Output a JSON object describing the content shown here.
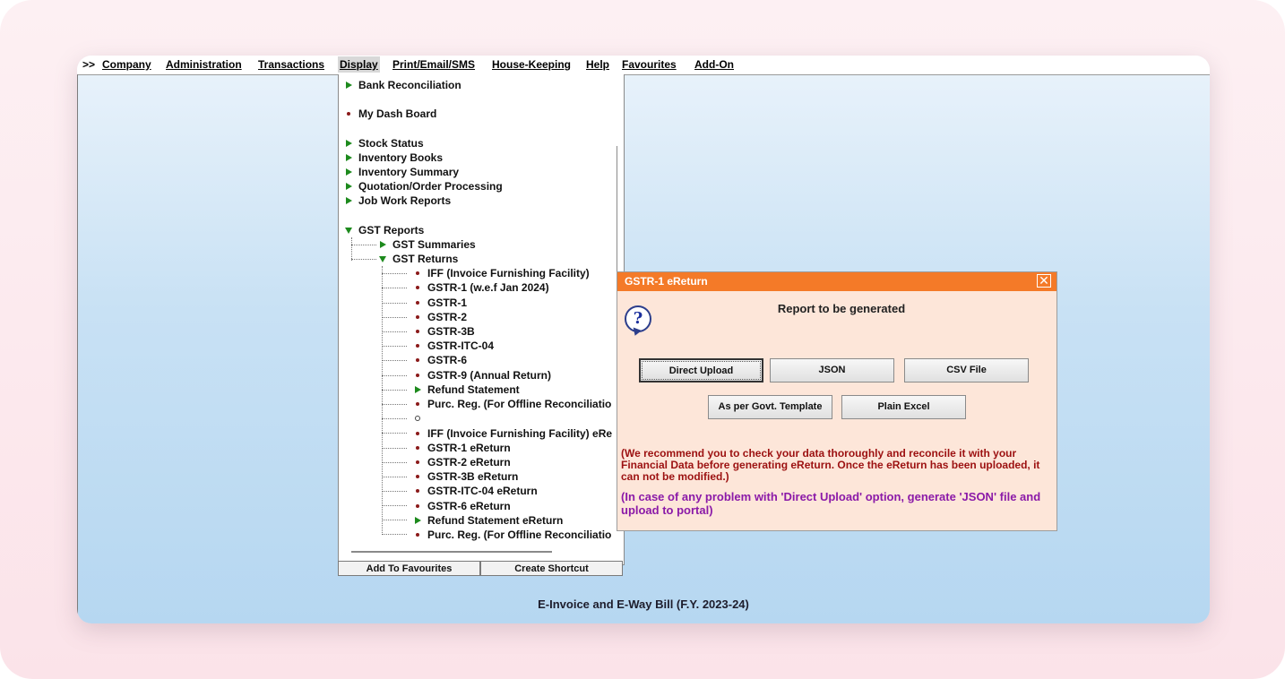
{
  "menubar": {
    "chevron": ">>",
    "items": [
      {
        "label": "Company"
      },
      {
        "label": "Administration"
      },
      {
        "label": "Transactions"
      },
      {
        "label": "Display"
      },
      {
        "label": "Print/Email/SMS"
      },
      {
        "label": "House-Keeping"
      },
      {
        "label": "Help"
      },
      {
        "label": "Favourites"
      },
      {
        "label": "Add-On"
      }
    ]
  },
  "tree": {
    "items": [
      {
        "label": "Bank Reconciliation",
        "icon": "triangle-right"
      },
      {
        "label": "My Dash Board",
        "icon": "dot"
      },
      {
        "label": "Stock Status",
        "icon": "triangle-right"
      },
      {
        "label": "Inventory Books",
        "icon": "triangle-right"
      },
      {
        "label": "Inventory Summary",
        "icon": "triangle-right"
      },
      {
        "label": "Quotation/Order Processing",
        "icon": "triangle-right"
      },
      {
        "label": "Job Work Reports",
        "icon": "triangle-right"
      },
      {
        "label": "GST Reports",
        "icon": "triangle-down"
      },
      {
        "label": "GST Summaries",
        "icon": "triangle-right"
      },
      {
        "label": "GST Returns",
        "icon": "triangle-down"
      },
      {
        "label": "IFF (Invoice Furnishing Facility)",
        "icon": "dot"
      },
      {
        "label": "GSTR-1 (w.e.f Jan 2024)",
        "icon": "dot"
      },
      {
        "label": "GSTR-1",
        "icon": "dot"
      },
      {
        "label": "GSTR-2",
        "icon": "dot"
      },
      {
        "label": "GSTR-3B",
        "icon": "dot"
      },
      {
        "label": "GSTR-ITC-04",
        "icon": "dot"
      },
      {
        "label": "GSTR-6",
        "icon": "dot"
      },
      {
        "label": "GSTR-9 (Annual Return)",
        "icon": "dot"
      },
      {
        "label": "Refund Statement",
        "icon": "triangle-right"
      },
      {
        "label": "Purc. Reg. (For Offline Reconciliatio",
        "icon": "dot"
      },
      {
        "label": "",
        "icon": "circle"
      },
      {
        "label": "IFF (Invoice Furnishing Facility) eRe",
        "icon": "dot"
      },
      {
        "label": "GSTR-1 eReturn",
        "icon": "dot"
      },
      {
        "label": "GSTR-2 eReturn",
        "icon": "dot"
      },
      {
        "label": "GSTR-3B eReturn",
        "icon": "dot"
      },
      {
        "label": "GSTR-ITC-04 eReturn",
        "icon": "dot"
      },
      {
        "label": "GSTR-6 eReturn",
        "icon": "dot"
      },
      {
        "label": "Refund Statement eReturn",
        "icon": "triangle-right"
      },
      {
        "label": "Purc. Reg. (For Offline Reconciliatio",
        "icon": "dot"
      }
    ]
  },
  "tree_footer": {
    "add_favourites": "Add To Favourites",
    "create_shortcut": "Create Shortcut"
  },
  "dialog": {
    "title": "GSTR-1 eReturn",
    "close": "✕",
    "help_icon": "?",
    "heading": "Report to be generated",
    "buttons": {
      "direct_upload": "Direct Upload",
      "json": "JSON",
      "csv": "CSV File",
      "govt_template": "As per Govt. Template",
      "plain_excel": "Plain Excel"
    },
    "note_red": "(We recommend you to check your data thoroughly and reconcile it with your Financial Data before generating eReturn. Once the eReturn has been uploaded, it can not be modified.)",
    "note_purple": "(In case of any problem with 'Direct Upload' option, generate 'JSON' file and upload to portal)"
  },
  "footer": {
    "text": "E-Invoice and E-Way Bill (F.Y. 2023-24)"
  },
  "colors": {
    "dialog_title_bg": "#f47a28",
    "dialog_bg": "#fde6d9",
    "note_red": "#9c1111",
    "note_purple": "#8b1aa8",
    "tree_arrow": "#1d8a1d",
    "tree_dot": "#8b1a1a"
  }
}
